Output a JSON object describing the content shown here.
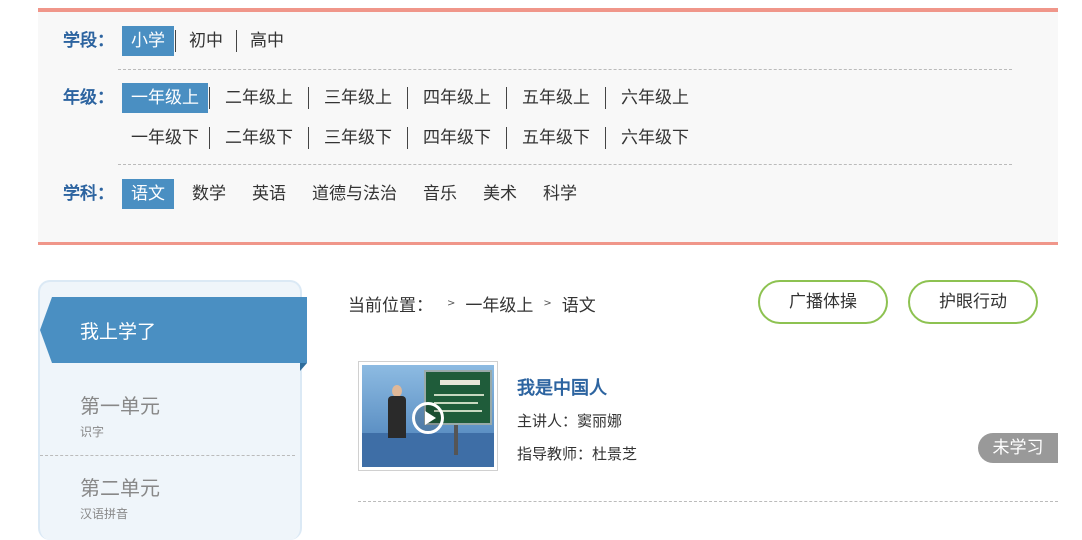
{
  "filters": {
    "stage": {
      "label": "学段：",
      "options": [
        "小学",
        "初中",
        "高中"
      ],
      "active": "小学"
    },
    "grade": {
      "label": "年级：",
      "options_upper": [
        "一年级上",
        "二年级上",
        "三年级上",
        "四年级上",
        "五年级上",
        "六年级上"
      ],
      "options_lower": [
        "一年级下",
        "二年级下",
        "三年级下",
        "四年级下",
        "五年级下",
        "六年级下"
      ],
      "active": "一年级上"
    },
    "subject": {
      "label": "学科：",
      "options": [
        "语文",
        "数学",
        "英语",
        "道德与法治",
        "音乐",
        "美术",
        "科学"
      ],
      "active": "语文"
    }
  },
  "sidebar": {
    "header": "我上学了",
    "units": [
      {
        "title": "第一单元",
        "subtitle": "识字"
      },
      {
        "title": "第二单元",
        "subtitle": "汉语拼音"
      }
    ]
  },
  "breadcrumb": {
    "label": "当前位置：",
    "sep": ">",
    "items": [
      "一年级上",
      "语文"
    ]
  },
  "actions": {
    "broadcast": "广播体操",
    "eye_care": "护眼行动"
  },
  "lesson": {
    "title": "我是中国人",
    "speaker": "主讲人：窦丽娜",
    "mentor": "指导教师：杜景芝",
    "status": "未学习"
  },
  "colors": {
    "accent": "#4a8fc2",
    "panel_border": "#f0968a",
    "pill_border": "#8dc251",
    "title_blue": "#2d64a0"
  }
}
